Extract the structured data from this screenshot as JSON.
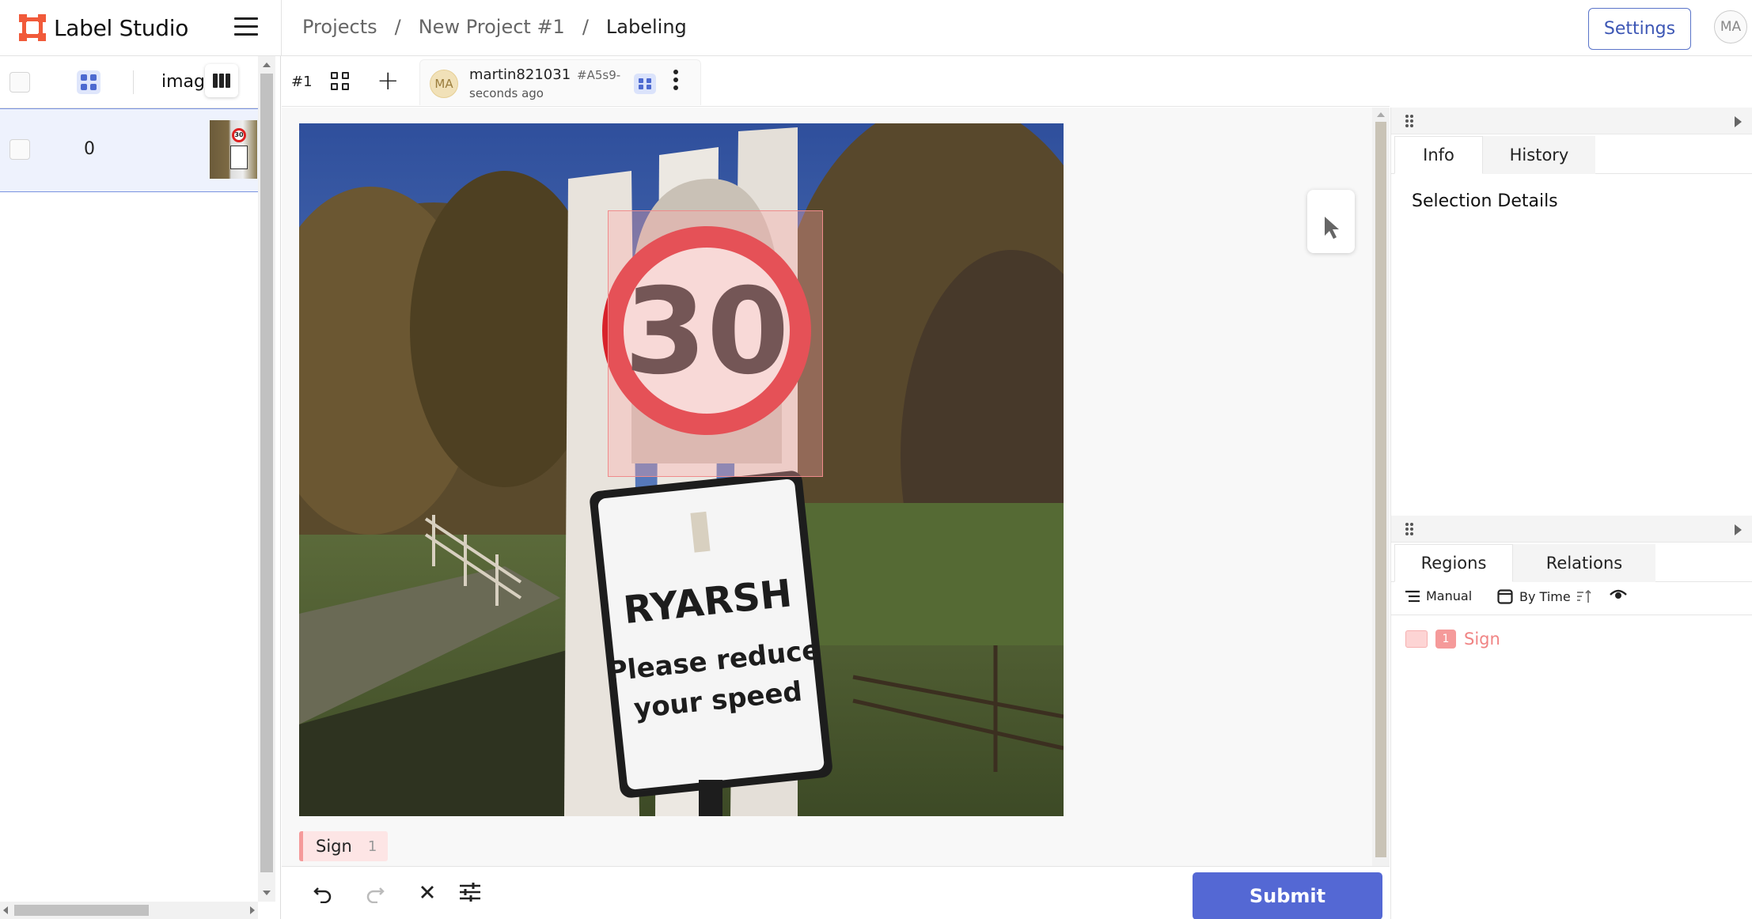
{
  "app": {
    "name": "Label Studio",
    "brand_color": "#f15a3a",
    "accent_color": "#5468d4"
  },
  "breadcrumb": {
    "items": [
      "Projects",
      "/",
      "New Project #1",
      "/",
      "Labeling"
    ]
  },
  "header": {
    "settings_label": "Settings",
    "user_initials": "MA"
  },
  "task_list": {
    "column_label": "image",
    "rows": [
      {
        "id": "0",
        "selected": true
      }
    ]
  },
  "annotation": {
    "number": "#1",
    "user": "martin821031",
    "hash": "#A5s9-",
    "time": "seconds ago",
    "initials": "MA"
  },
  "image": {
    "sign_speed": "30",
    "sign_town": "RYARSH",
    "sign_line1": "Please reduce",
    "sign_line2": "your speed"
  },
  "labels": [
    {
      "name": "Sign",
      "hotkey": "1",
      "color": "#f59a9a"
    }
  ],
  "controls": {
    "undo_icon": "undo-icon",
    "redo_icon": "redo-icon",
    "reset_icon": "close-icon",
    "settings_icon": "sliders-icon",
    "submit_label": "Submit"
  },
  "side_panel": {
    "top_tabs": [
      "Info",
      "History"
    ],
    "selection_title": "Selection Details",
    "bottom_tabs": [
      "Regions",
      "Relations"
    ],
    "group_label": "Manual",
    "order_label": "By Time",
    "regions": [
      {
        "index": "1",
        "label": "Sign"
      }
    ]
  }
}
